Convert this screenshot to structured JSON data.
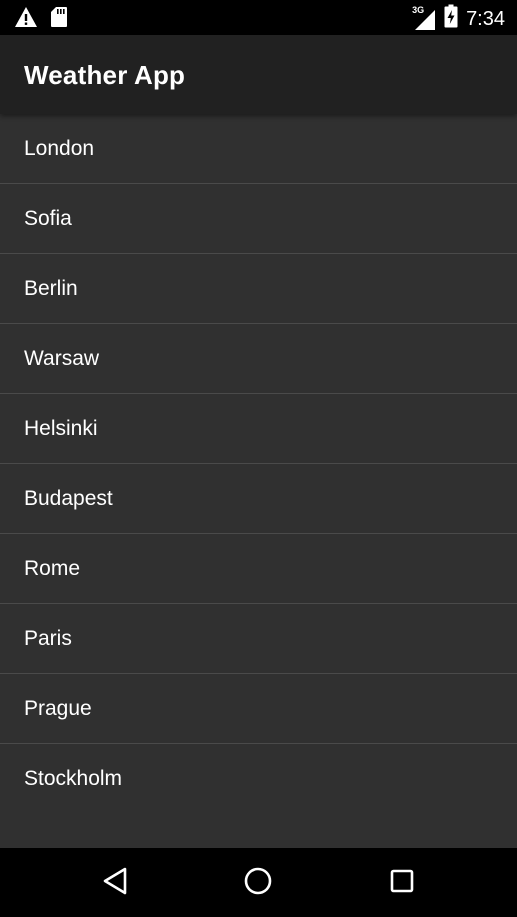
{
  "status_bar": {
    "time": "7:34",
    "network_type": "3G",
    "icons": [
      "warning-icon",
      "sd-card-icon",
      "signal-icon",
      "battery-charging-icon"
    ]
  },
  "app_bar": {
    "title": "Weather App"
  },
  "cities": [
    {
      "label": "London"
    },
    {
      "label": "Sofia"
    },
    {
      "label": "Berlin"
    },
    {
      "label": "Warsaw"
    },
    {
      "label": "Helsinki"
    },
    {
      "label": "Budapest"
    },
    {
      "label": "Rome"
    },
    {
      "label": "Paris"
    },
    {
      "label": "Prague"
    },
    {
      "label": "Stockholm"
    }
  ],
  "nav_bar": {
    "icons": [
      "back-icon",
      "home-icon",
      "recents-icon"
    ]
  },
  "colors": {
    "status_bar_bg": "#000000",
    "app_bar_bg": "#212121",
    "list_bg": "#303030",
    "divider": "#4a4a4a",
    "text": "#ffffff"
  }
}
